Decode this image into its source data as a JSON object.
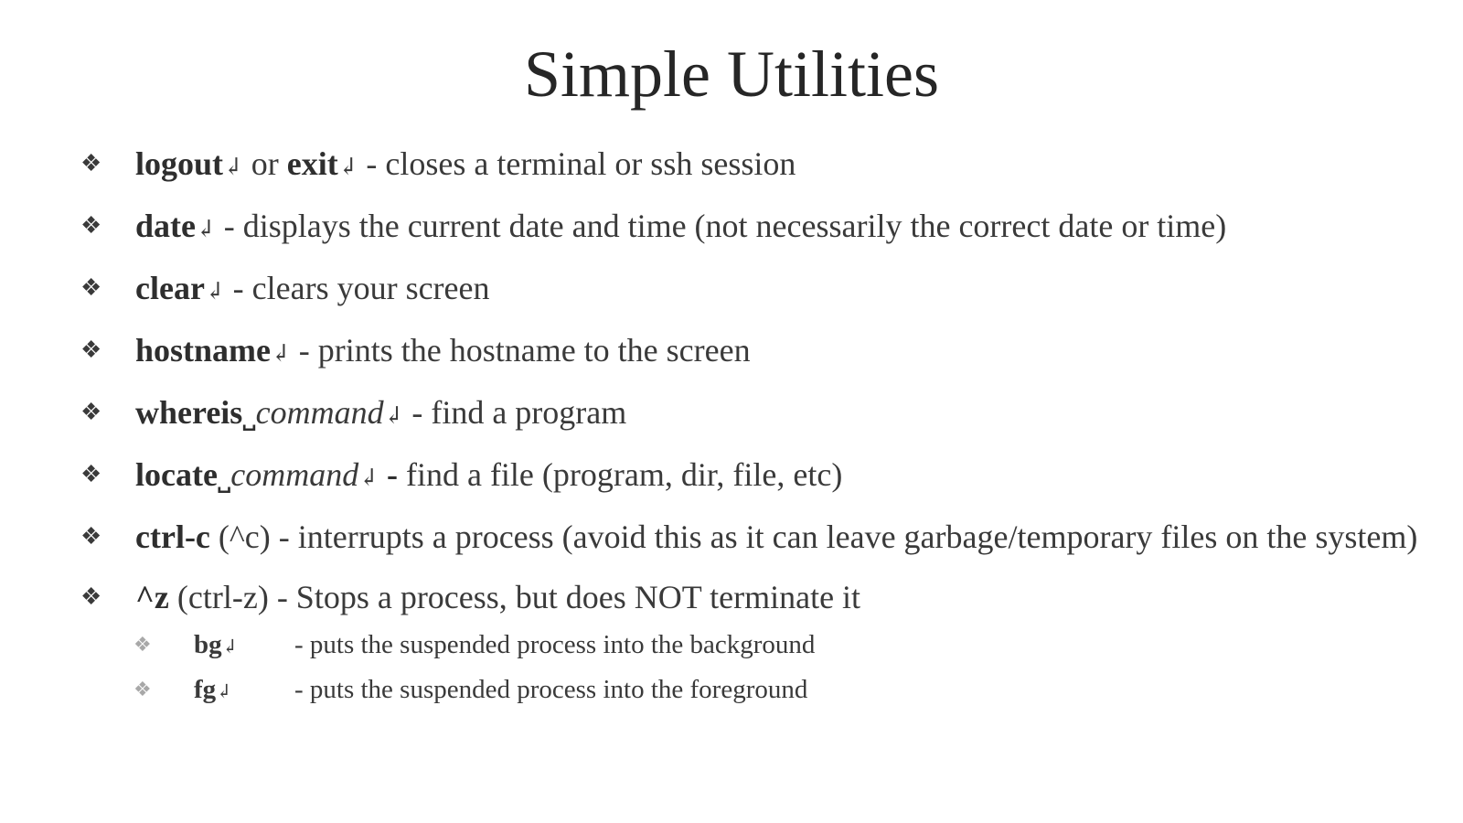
{
  "title": "Simple Utilities",
  "bullet_marker": "❖",
  "enter_symbol": "↲",
  "space_symbol": "˽",
  "bullets": [
    {
      "cmd1": "logout",
      "mid": " or ",
      "cmd2": "exit",
      "desc": " - closes a terminal or ssh session"
    },
    {
      "cmd": "date",
      "desc": " - displays the current date and time (not necessarily the correct date or time)"
    },
    {
      "cmd": "clear",
      "desc": " - clears your screen"
    },
    {
      "cmd": "hostname",
      "desc": " - prints the hostname to the screen"
    },
    {
      "cmd": "whereis",
      "arg": "command",
      "desc": " - find a program"
    },
    {
      "cmd": "locate",
      "arg": "command",
      "dash": " -",
      "desc": " find a file (program, dir, file, etc)"
    },
    {
      "cmd": "ctrl-c",
      "desc": " (^c) - interrupts a process (avoid this as it can leave garbage/temporary files on the system)"
    },
    {
      "cmd": "^z",
      "desc": " (ctrl-z) - Stops a process, but does NOT terminate it"
    }
  ],
  "sub_bullets": [
    {
      "cmd": "bg",
      "desc": "- puts the suspended process into the background"
    },
    {
      "cmd": "fg",
      "desc": "- puts the suspended process into the foreground"
    }
  ]
}
